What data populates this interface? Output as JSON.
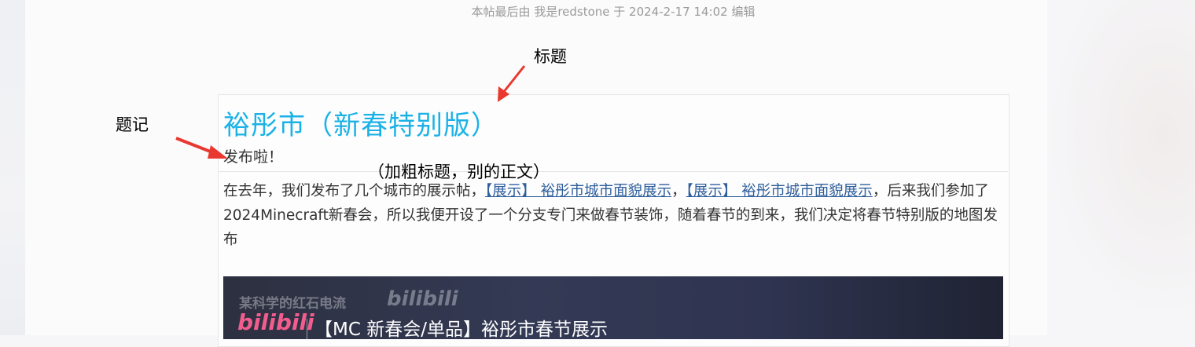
{
  "edit_note": "本帖最后由 我是redstone 于 2024-2-17 14:02 编辑",
  "annotations": {
    "title_label": "标题",
    "tiji_label": "题记",
    "bold_label": "（加粗标题，别的正文）"
  },
  "post": {
    "title": "裕彤市（新春特别版）",
    "subtitle": "发布啦！",
    "body_before": "在去年，我们发布了几个城市的展示帖，",
    "link1": "【展示】 裕彤市城市面貌展示",
    "sep": "，",
    "link2": "【展示】 裕彤市城市面貌展示",
    "body_after": "，后来我们参加了2024Minecraft新春会，所以我便开设了一个分支专门来做春节装饰，随着春节的到来，我们决定将春节特别版的地图发布"
  },
  "video": {
    "watermark": "某科学的红石电流",
    "watermark_logo": "bilibili",
    "logo": "bilibili",
    "title": "【MC 新春会/单品】裕彤市春节展示"
  },
  "colors": {
    "title": "#1ab2e6",
    "link": "#2f5f9c",
    "arrow": "#e8382f",
    "bilibili_pink": "#f25d8e"
  }
}
